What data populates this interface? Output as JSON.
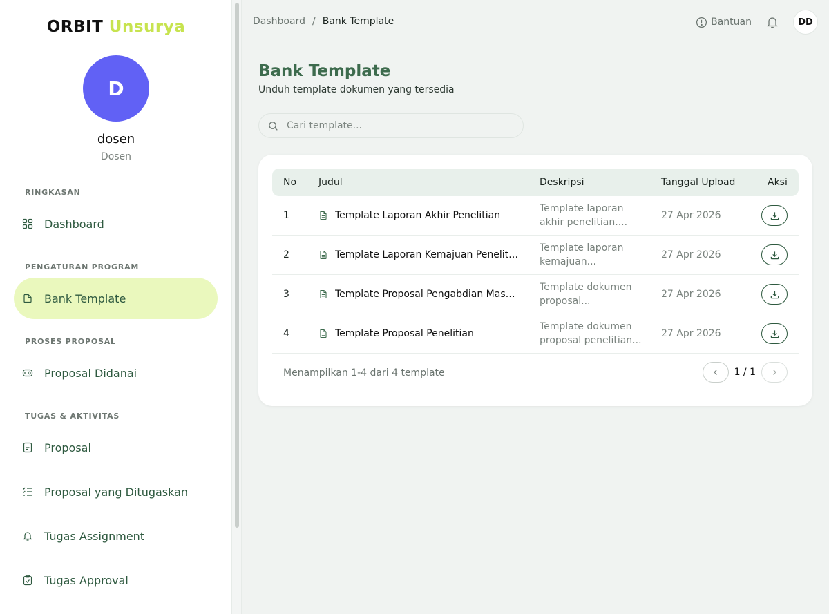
{
  "brand": {
    "part1": "ORBIT",
    "part2": "Unsurya"
  },
  "user": {
    "initial": "D",
    "name": "dosen",
    "role": "Dosen",
    "avatar_initials": "DD"
  },
  "sidebar": {
    "sections": [
      {
        "label": "RINGKASAN"
      },
      {
        "label": "PENGATURAN PROGRAM"
      },
      {
        "label": "PROSES PROPOSAL"
      },
      {
        "label": "TUGAS & AKTIVITAS"
      }
    ],
    "items": [
      {
        "label": "Dashboard",
        "icon": "grid-icon"
      },
      {
        "label": "Bank Template",
        "icon": "file-icon",
        "active": true
      },
      {
        "label": "Proposal Didanai",
        "icon": "money-icon"
      },
      {
        "label": "Proposal",
        "icon": "document-icon"
      },
      {
        "label": "Proposal yang Ditugaskan",
        "icon": "checklist-icon"
      },
      {
        "label": "Tugas Assignment",
        "icon": "bell-icon"
      },
      {
        "label": "Tugas Approval",
        "icon": "clipboard-check-icon"
      }
    ]
  },
  "header": {
    "breadcrumb": {
      "root": "Dashboard",
      "separator": "/",
      "current": "Bank Template"
    },
    "help_label": "Bantuan"
  },
  "page": {
    "title": "Bank Template",
    "subtitle": "Unduh template dokumen yang tersedia"
  },
  "search": {
    "placeholder": "Cari template..."
  },
  "table": {
    "headers": {
      "no": "No",
      "title": "Judul",
      "desc": "Deskripsi",
      "date": "Tanggal Upload",
      "action": "Aksi"
    },
    "rows": [
      {
        "no": "1",
        "title": "Template Laporan Akhir Penelitian",
        "desc1": "Template laporan",
        "desc2": "akhir penelitian....",
        "date": "27 Apr 2026"
      },
      {
        "no": "2",
        "title": "Template Laporan Kemajuan Penelitian",
        "desc1": "Template laporan",
        "desc2": "kemajuan...",
        "date": "27 Apr 2026"
      },
      {
        "no": "3",
        "title": "Template Proposal Pengabdian Masyarakat",
        "desc1": "Template dokumen",
        "desc2": "proposal...",
        "date": "27 Apr 2026"
      },
      {
        "no": "4",
        "title": "Template Proposal Penelitian",
        "desc1": "Template dokumen",
        "desc2": "proposal penelitian...",
        "date": "27 Apr 2026"
      }
    ],
    "footer_text": "Menampilkan 1-4 dari 4 template",
    "page_indicator": "1 / 1"
  },
  "colors": {
    "accent": "#c7e34f",
    "brand_green": "#2f5a40",
    "avatar": "#6161f5",
    "active_bg": "#eaf8bd"
  }
}
